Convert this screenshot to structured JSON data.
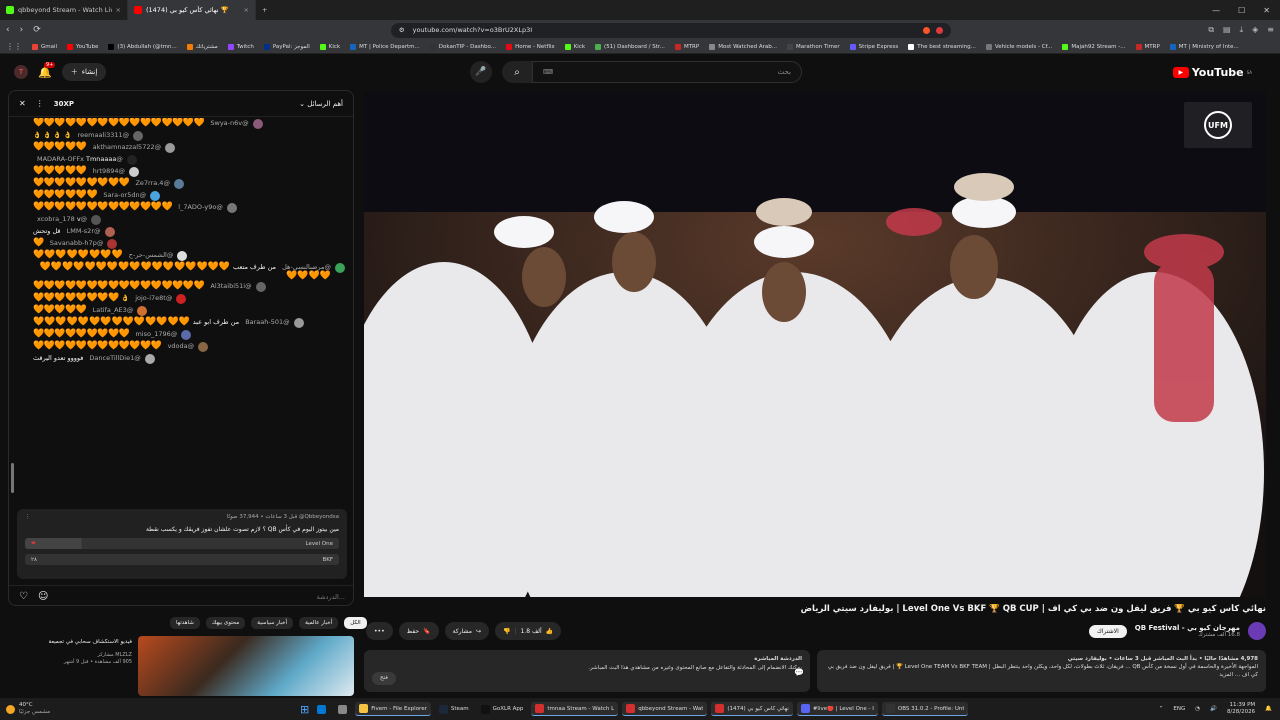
{
  "tabs": [
    {
      "title": "qbbeyond Stream - Watch Live on K",
      "color": "#53fc18",
      "active": false
    },
    {
      "title": "(1474) نهائي كأس كيو بي 🏆",
      "color": "#ff0000",
      "active": true
    },
    {
      "title": "+",
      "color": "",
      "active": false
    }
  ],
  "window": {
    "minimize": "—",
    "maximize": "☐",
    "close": "✕"
  },
  "address": {
    "url": "youtube.com/watch?v=o3BrU2XLp3I"
  },
  "bookmarks": [
    {
      "label": "Gmail",
      "color": "#ea4335"
    },
    {
      "label": "YouTube",
      "color": "#ff0000"
    },
    {
      "label": "(3) Abdullah (@tmn...",
      "color": "#000000"
    },
    {
      "label": "مشترياتك",
      "color": "#f57c00"
    },
    {
      "label": "Twitch",
      "color": "#9146ff"
    },
    {
      "label": "PayPal: الموجز",
      "color": "#003087"
    },
    {
      "label": "Kick",
      "color": "#53fc18"
    },
    {
      "label": "MT | Police Departm...",
      "color": "#1565c0"
    },
    {
      "label": "DokanTIP - Dashbo...",
      "color": "#333333"
    },
    {
      "label": "Home - Netflix",
      "color": "#e50914"
    },
    {
      "label": "Kick",
      "color": "#53fc18"
    },
    {
      "label": "(51) Dashboard / Str...",
      "color": "#4caf50"
    },
    {
      "label": "MTRP",
      "color": "#c62828"
    },
    {
      "label": "Most Watched Arab...",
      "color": "#888888"
    },
    {
      "label": "Marathon Timer",
      "color": "#444444"
    },
    {
      "label": "Stripe Express",
      "color": "#635bff"
    },
    {
      "label": "The best streaming...",
      "color": "#ffffff"
    },
    {
      "label": "Vehicle models - Cf...",
      "color": "#777777"
    },
    {
      "label": "Majah92 Stream -...",
      "color": "#53fc18"
    },
    {
      "label": "MTRP",
      "color": "#c62828"
    },
    {
      "label": "MT | Ministry of Inte...",
      "color": "#1565c0"
    }
  ],
  "youtube": {
    "create_label": "إنشاء",
    "notif_count": "9+",
    "search_placeholder": "بحث",
    "logo_text": "YouTube",
    "logo_region": "SA"
  },
  "chat": {
    "xp_label": "30XP",
    "sort_label": "أهم الرسائل",
    "messages": [
      {
        "user": "@Swya-n6v",
        "text": "",
        "hearts": 16,
        "avatar": "#8a5a7a"
      },
      {
        "user": "@reemaali3311",
        "text": "👌 👌 👌 👌",
        "hearts": 0,
        "avatar": "#666666"
      },
      {
        "user": "@akthamnazzal5722",
        "text": "",
        "hearts": 5,
        "avatar": "#9a9a9a"
      },
      {
        "user": "@MADARA-OFFx",
        "text": "Tmnaaaa",
        "hearts": 0,
        "avatar": "#222222"
      },
      {
        "user": "@hrt9894",
        "text": "",
        "hearts": 5,
        "avatar": "#cccccc"
      },
      {
        "user": "@Ze7rra.4",
        "text": "",
        "hearts": 9,
        "avatar": "#5a7a9a"
      },
      {
        "user": "@Sara-or5dn",
        "text": "",
        "hearts": 6,
        "avatar": "#4aa3df"
      },
      {
        "user": "@l_7ADO-y9o",
        "text": "",
        "hearts": 13,
        "avatar": "#777777"
      },
      {
        "user": "@xcobra_178",
        "text": "v",
        "hearts": 0,
        "avatar": "#555555"
      },
      {
        "user": "@LMM-s2r",
        "text": "قل وتحش",
        "hearts": 0,
        "avatar": "#b06050"
      },
      {
        "user": "@Savanabb-h7p",
        "text": "",
        "hearts": 1,
        "avatar": "#aa3333"
      },
      {
        "user": "@الشمس-حر-ح",
        "text": "",
        "hearts": 8,
        "avatar": "#dddddd"
      },
      {
        "user": "@مرضىالنسي-هل",
        "text": "من طرف متعب",
        "hearts": 21,
        "avatar": "#3aa35a"
      },
      {
        "user": "@Al3taibi51i",
        "text": "",
        "hearts": 16,
        "avatar": "#666666"
      },
      {
        "user": "@jojo-i7e8t",
        "text": "👌",
        "hearts": 8,
        "avatar": "#cc2222"
      },
      {
        "user": "@Latifa_AE3",
        "text": "",
        "hearts": 5,
        "avatar": "#d07030"
      },
      {
        "user": "@Baraah-501",
        "text": "من طرف ابو عبد",
        "hearts": 14,
        "avatar": "#999999"
      },
      {
        "user": "@miso_1796",
        "text": "",
        "hearts": 9,
        "avatar": "#5a6aaa"
      },
      {
        "user": "@vdoda",
        "text": "",
        "hearts": 12,
        "avatar": "#886644"
      },
      {
        "user": "@DanceTillDie1",
        "text": "فوووو تعدو اليرقث",
        "hearts": 0,
        "avatar": "#aaaaaa"
      }
    ],
    "poll": {
      "author": "@Qbbeyondsa",
      "meta": "قبل 3 ساعات • 37,944 صوتًا",
      "question": "مين بيتوز اليوم في كأس QB ؟ لازم تصوت علشان تفوز فريقك و يكسب نقطة",
      "options": [
        {
          "label": "Level One",
          "value": ""
        },
        {
          "label": "BKF",
          "value": "٢٨"
        }
      ],
      "leading_share": 0.18
    },
    "input_placeholder": "الدردشة..."
  },
  "video": {
    "watermark": "UFM",
    "title": "نهائي كأس كيو بي 🏆 فريق ليفل ون ضد بي كي اف | Level One Vs BKF 🏆 QB CUP | بوليفارد سيتي الرياض",
    "likes": "1.8 ألف",
    "share_label": "مشاركة",
    "save_label": "حفظ",
    "more_label": "•••"
  },
  "channel": {
    "name": "مهرجان كيو بي - QB Festival",
    "subs": "16.8 ألف مشترك",
    "subscribe_label": "الاشتراك"
  },
  "description": {
    "stats": "4,978 مشاهدًا حاليًا • بدأ البث المباشر قبل 3 ساعات • بوليفارد سيتي",
    "text": "المواجهة الأخيرة والحاسمة في أول نسخة من كأس QB ... فريقان، ثلاث بطولات، لكل واحد، ويكلن واحد ينتظر البطل | Level One TEAM Vs BKF TEAM 🏆 | فريق ليفل ون ضد فريق بي كي اف ... المزيد"
  },
  "chat_replay": {
    "title": "الدردشة المباشرة",
    "text": "يمكنك الانضمام إلى المحادثة والتفاعل مع صانع المحتوى وغيره من مشاهدي هذا البث المباشر.",
    "button": "فتح"
  },
  "chips": [
    {
      "label": "الكل",
      "on": true
    },
    {
      "label": "أخبار عالمية",
      "on": false
    },
    {
      "label": "أخبار سياسية",
      "on": false
    },
    {
      "label": "محتوى بيهك",
      "on": false
    },
    {
      "label": "شاهدتها",
      "on": false
    }
  ],
  "recommendation": {
    "title": "فيديو الاستكشاف سحابي في تجميعة",
    "channel": "MLZLZ مشاركر",
    "meta": "905 ألف مشاهدة • قبل 9 أشهر"
  },
  "taskbar": {
    "weather_temp": "40°C",
    "weather_desc": "مشمس جزئيًا",
    "items": [
      {
        "label": "",
        "color": "#0078d4",
        "open": false
      },
      {
        "label": "",
        "color": "#888888",
        "open": false
      },
      {
        "label": "Fivem - File Explorer",
        "color": "#f5c542",
        "open": true
      },
      {
        "label": "Steam",
        "color": "#1b2838",
        "open": false
      },
      {
        "label": "GoXLR App",
        "color": "#111111",
        "open": false
      },
      {
        "label": "tmnaa Stream - Watch L",
        "color": "#d32f2f",
        "open": true
      },
      {
        "label": "qbbeyond Stream - Wat",
        "color": "#d32f2f",
        "open": true
      },
      {
        "label": "(1474) نهائي كأس كيو بي",
        "color": "#d32f2f",
        "open": true
      },
      {
        "label": "#live🔴 | Level One - I",
        "color": "#5865f2",
        "open": true
      },
      {
        "label": "OBS 31.0.2 - Profile: Unt",
        "color": "#333333",
        "open": true
      }
    ],
    "lang": "ENG",
    "time": "11:39 PM",
    "date": "8/28/2026"
  }
}
